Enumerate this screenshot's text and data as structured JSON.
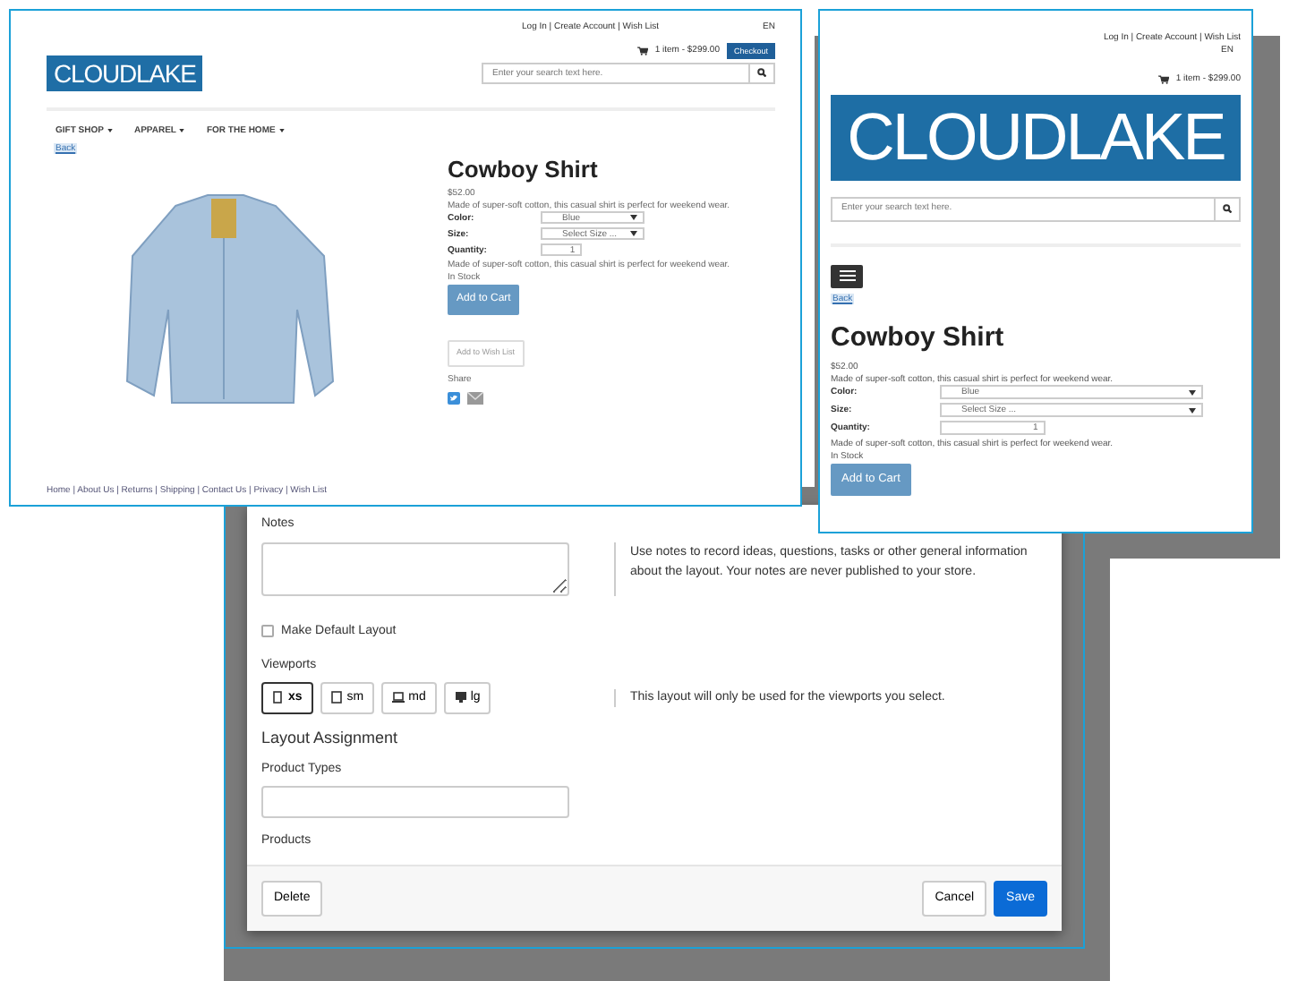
{
  "desktop_view": {
    "account_links": "Log In | Create Account | Wish List",
    "language": "EN",
    "cart": "1 item - $299.00",
    "checkout": "Checkout",
    "logo": "CLOUDLAKE",
    "search": {
      "placeholder": "Enter your search text here."
    },
    "nav": [
      "GIFT SHOP",
      "APPAREL",
      "FOR THE HOME"
    ],
    "back": "Back",
    "product": {
      "title": "Cowboy Shirt",
      "price": "$52.00",
      "description": "Made of super-soft cotton, this casual shirt is perfect for weekend wear.",
      "options": [
        {
          "label": "Color:",
          "value": "Blue",
          "kind": "select"
        },
        {
          "label": "Size:",
          "value": "Select Size ...",
          "kind": "select"
        },
        {
          "label": "Quantity:",
          "value": "1",
          "kind": "number"
        }
      ],
      "description_2": "Made of super-soft cotton, this casual shirt is perfect for weekend wear.",
      "stock": "In Stock",
      "add_to_cart": "Add to Cart",
      "wish_list": "Add to Wish List",
      "share": "Share"
    },
    "footer": "Home | About Us | Returns | Shipping | Contact Us | Privacy | Wish List"
  },
  "mobile_view": {
    "account_links": "Log In | Create Account | Wish List",
    "language": "EN",
    "cart": "1 item - $299.00",
    "logo": "CLOUDLAKE",
    "search": {
      "placeholder": "Enter your search text here."
    },
    "back": "Back",
    "product": {
      "title": "Cowboy Shirt",
      "price": "$52.00",
      "description": "Made of super-soft cotton, this casual shirt is perfect for weekend wear.",
      "options": [
        {
          "label": "Color:",
          "value": "Blue",
          "kind": "select"
        },
        {
          "label": "Size:",
          "value": "Select Size ...",
          "kind": "select"
        },
        {
          "label": "Quantity:",
          "value": "1",
          "kind": "number"
        }
      ],
      "description_2": "Made of super-soft cotton, this casual shirt is perfect for weekend wear.",
      "stock": "In Stock",
      "add_to_cart": "Add to Cart"
    }
  },
  "dialog": {
    "notes_label": "Notes",
    "notes_help": "Use notes to record ideas, questions, tasks or other general information about the layout. Your notes are never published to your store.",
    "default_layout": {
      "label": "Make Default Layout",
      "checked": false
    },
    "viewports_label": "Viewports",
    "viewports": [
      {
        "label": "xs",
        "kind": "phone",
        "selected": true
      },
      {
        "label": "sm",
        "kind": "tablet",
        "selected": false
      },
      {
        "label": "md",
        "kind": "laptop",
        "selected": false
      },
      {
        "label": "lg",
        "kind": "desktop",
        "selected": false
      }
    ],
    "viewports_help": "This layout will only be used for the viewports you select.",
    "section_title": "Layout Assignment",
    "product_types_label": "Product Types",
    "products_label": "Products",
    "buttons": {
      "delete": "Delete",
      "cancel": "Cancel",
      "save": "Save"
    }
  }
}
